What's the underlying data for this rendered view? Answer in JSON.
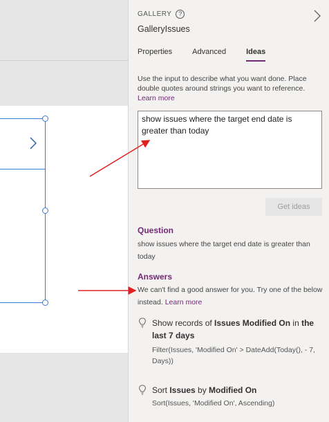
{
  "panel": {
    "control_type": "GALLERY",
    "control_name": "GalleryIssues",
    "tabs": [
      {
        "label": "Properties",
        "active": false
      },
      {
        "label": "Advanced",
        "active": false
      },
      {
        "label": "Ideas",
        "active": true
      }
    ],
    "description": "Use the input to describe what you want done. Place double quotes around strings you want to reference.",
    "learn_more": "Learn more",
    "input_value": "show issues where the target end date is greater than today",
    "get_ideas_label": "Get ideas",
    "question_title": "Question",
    "question_text": "show issues where the target end date is greater than today",
    "answers_title": "Answers",
    "answers_text": "We can't find a good answer for you. Try one of the below instead.",
    "answers_learn_more": "Learn more",
    "suggestions": [
      {
        "pre": "Show records of ",
        "bold1": "Issues Modified On",
        "mid": " in ",
        "bold2": "the last 7 days",
        "formula": "Filter(Issues, 'Modified On' > DateAdd(Today(), - 7, Days))"
      },
      {
        "pre": "Sort ",
        "bold1": "Issues",
        "mid": " by ",
        "bold2": "Modified On",
        "formula": "Sort(Issues, 'Modified On', Ascending)"
      }
    ]
  },
  "colors": {
    "accent": "#742774",
    "selection": "#3a7bd5",
    "arrow": "#e02020"
  },
  "icons": {
    "help": "help-circle-icon",
    "panel_chevron": "chevron-right-icon",
    "gallery_chevron": "chevron-right-icon",
    "bulb": "lightbulb-icon"
  }
}
